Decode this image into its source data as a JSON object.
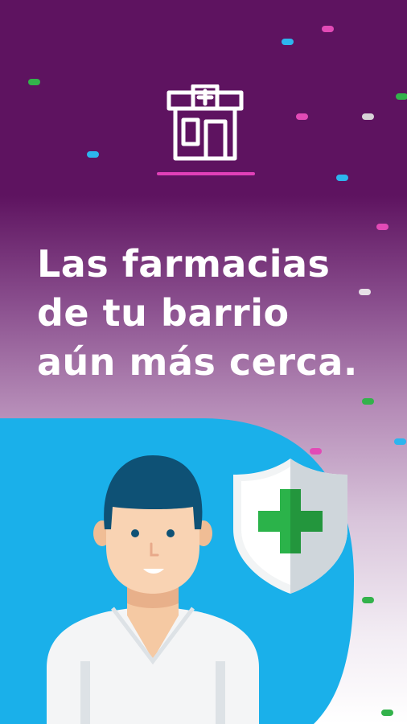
{
  "headline": {
    "line1": "Las farmacias",
    "line2": "de tu barrio",
    "line3": "aún más cerca."
  },
  "icons": {
    "logo": "pharmacy-store-icon",
    "shield": "medical-cross-shield-icon",
    "character": "pharmacist-illustration"
  },
  "colors": {
    "background_top": "#5e1360",
    "accent_pink": "#e040b8",
    "blob_blue": "#1ab0ea",
    "cross_green": "#2bb34a",
    "hair": "#0e5175"
  }
}
